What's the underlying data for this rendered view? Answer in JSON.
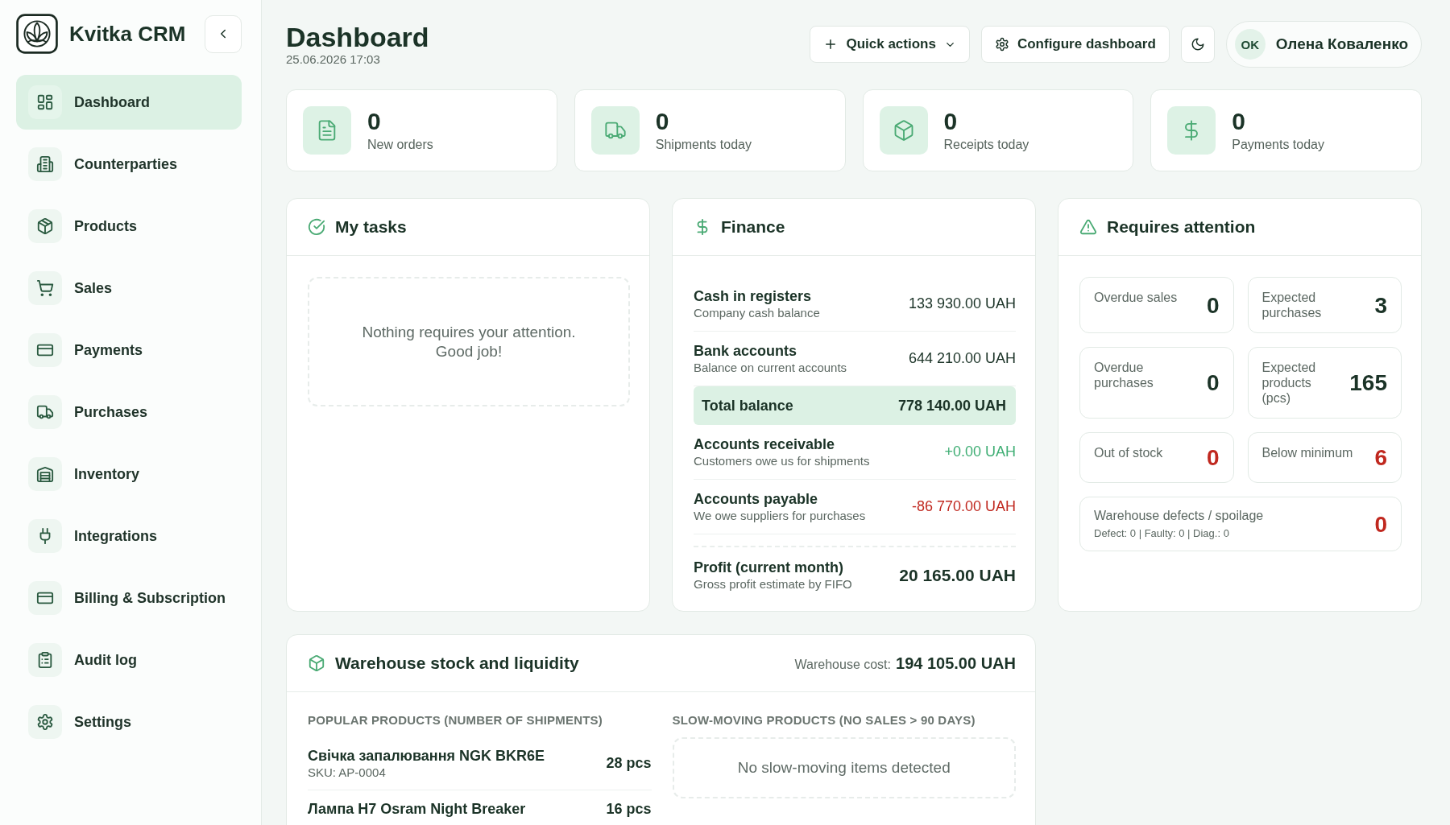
{
  "sidebar": {
    "brand": "Kvitka CRM",
    "items": [
      {
        "kind": "dashboard",
        "label": "Dashboard",
        "selected": true
      },
      {
        "kind": "counterparties",
        "label": "Counterparties",
        "selected": false
      },
      {
        "kind": "products",
        "label": "Products",
        "selected": false
      },
      {
        "kind": "sales",
        "label": "Sales",
        "selected": false
      },
      {
        "kind": "payments",
        "label": "Payments",
        "selected": false
      },
      {
        "kind": "purchases",
        "label": "Purchases",
        "selected": false
      },
      {
        "kind": "inventory",
        "label": "Inventory",
        "selected": false
      },
      {
        "kind": "integrations",
        "label": "Integrations",
        "selected": false
      },
      {
        "kind": "billing",
        "label": "Billing & Subscription",
        "selected": false
      },
      {
        "kind": "audit",
        "label": "Audit log",
        "selected": false
      },
      {
        "kind": "settings",
        "label": "Settings",
        "selected": false
      }
    ]
  },
  "header": {
    "title": "Dashboard",
    "date": "25.06.2026 17:03",
    "actions": [
      {
        "kind": "menu",
        "label": "Quick actions"
      },
      {
        "kind": "configure",
        "label": "Configure dashboard"
      },
      {
        "kind": "theme"
      }
    ],
    "user": {
      "initials": "OK",
      "name": "Олена Коваленко"
    }
  },
  "stats": [
    {
      "kind": "orders",
      "value": "0",
      "label": "New orders"
    },
    {
      "kind": "shipments",
      "value": "0",
      "label": "Shipments today"
    },
    {
      "kind": "receipts",
      "value": "0",
      "label": "Receipts today"
    },
    {
      "kind": "payments",
      "value": "0",
      "label": "Payments today"
    }
  ],
  "tasks": {
    "title": "My tasks",
    "empty_text": "Nothing requires your attention. Good job!"
  },
  "finance": {
    "title": "Finance",
    "rows": [
      {
        "kind": "line",
        "label": "Cash in registers",
        "description": "Company cash balance",
        "amount": "133 930.00 UAH",
        "color": "#1b3327"
      },
      {
        "kind": "line",
        "label": "Bank accounts",
        "description": "Balance on current accounts",
        "amount": "644 210.00 UAH",
        "color": "#1b3327"
      },
      {
        "kind": "total",
        "label": "Total balance",
        "amount": "778 140.00 UAH"
      },
      {
        "kind": "line",
        "label": "Accounts receivable",
        "description": "Customers owe us for shipments",
        "amount": "+0.00 UAH",
        "color": "#3fae74"
      },
      {
        "kind": "line",
        "label": "Accounts payable",
        "description": "We owe suppliers for purchases",
        "amount": "-86 770.00 UAH",
        "color": "#c0281f"
      },
      {
        "kind": "profit",
        "label": "Profit (current month)",
        "description": "Gross profit estimate by FIFO",
        "amount": "20 165.00 UAH"
      }
    ]
  },
  "attention": {
    "title": "Requires attention",
    "tiles": [
      {
        "kind": "single",
        "label": "Overdue sales",
        "value": "0",
        "alert": false
      },
      {
        "kind": "single",
        "label": "Expected purchases",
        "value": "3",
        "alert": false
      },
      {
        "kind": "single",
        "label": "Overdue purchases",
        "value": "0",
        "alert": false
      },
      {
        "kind": "single",
        "label": "Expected products (pcs)",
        "value": "165",
        "alert": false
      },
      {
        "kind": "single",
        "label": "Out of stock",
        "value": "0",
        "alert": true
      },
      {
        "kind": "single",
        "label": "Below minimum",
        "value": "6",
        "alert": true
      },
      {
        "kind": "wide",
        "label": "Warehouse defects / spoilage",
        "detail": "Defect: 0 | Faulty: 0 | Diag.: 0",
        "value": "0",
        "alert": true
      }
    ]
  },
  "warehouse": {
    "title": "Warehouse stock and liquidity",
    "cost_label": "Warehouse cost:",
    "cost_value": "194 105.00 UAH",
    "popular": {
      "heading": "POPULAR PRODUCTS (NUMBER OF SHIPMENTS)",
      "items": [
        {
          "name": "Свічка запалювання NGK BKR6E",
          "sku": "SKU: AP-0004",
          "count": "28 pcs"
        },
        {
          "name": "Лампа H7 Osram Night Breaker",
          "count": "16 pcs"
        }
      ]
    },
    "slow_moving": {
      "heading": "SLOW-MOVING PRODUCTS (NO SALES > 90 DAYS)",
      "empty_text": "No slow-moving items detected"
    }
  }
}
